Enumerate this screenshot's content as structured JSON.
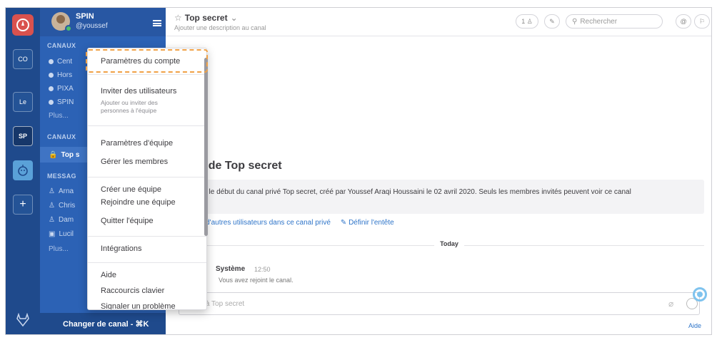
{
  "teams": {
    "items": [
      {
        "label": "CO"
      },
      {
        "label": "Le"
      },
      {
        "label": "SP"
      }
    ],
    "add_label": "+"
  },
  "sidebar": {
    "team_name": "SPIN",
    "username": "@youssef",
    "section_channels": "CANAUX",
    "channels": [
      "Cent",
      "Hors",
      "PIXA",
      "SPIN"
    ],
    "more": "Plus...",
    "section_private": "CANAUX",
    "private_channel": "Top s",
    "section_messages": "MESSAG",
    "messages": [
      "Arna",
      "Chris",
      "Dam",
      "Lucil"
    ],
    "messages_more": "Plus...",
    "switch_channel": "Changer de canal - ⌘K"
  },
  "header": {
    "channel_name": "Top secret",
    "channel_desc": "Ajouter une description au canal",
    "member_count": "1",
    "search_placeholder": "Rechercher"
  },
  "menu": {
    "account_settings": "Paramètres du compte",
    "invite_users": "Inviter des utilisateurs",
    "invite_users_sub": "Ajouter ou inviter des personnes à l'équipe",
    "team_settings": "Paramètres d'équipe",
    "manage_members": "Gérer les membres",
    "create_team": "Créer une équipe",
    "join_team": "Rejoindre une équipe",
    "leave_team": "Quitter l'équipe",
    "integrations": "Intégrations",
    "help": "Aide",
    "shortcuts": "Raccourcis clavier",
    "report_problem": "Signaler un problème"
  },
  "main": {
    "intro_title": "t de Top secret",
    "intro_text": "st le début du canal privé Top secret, créé par Youssef Araqi Houssaini le 02 avril 2020. Seuls les membres invités peuvent voir ce canal",
    "link_add": "r d'autres utilisateurs dans ce canal privé",
    "link_header": "Définir l'entête",
    "today": "Today",
    "post_author": "Système",
    "post_time": "12:50",
    "post_text": "Vous avez rejoint le canal.",
    "composer_placeholder": "Écrire à Top secret",
    "help_link": "Aide"
  }
}
